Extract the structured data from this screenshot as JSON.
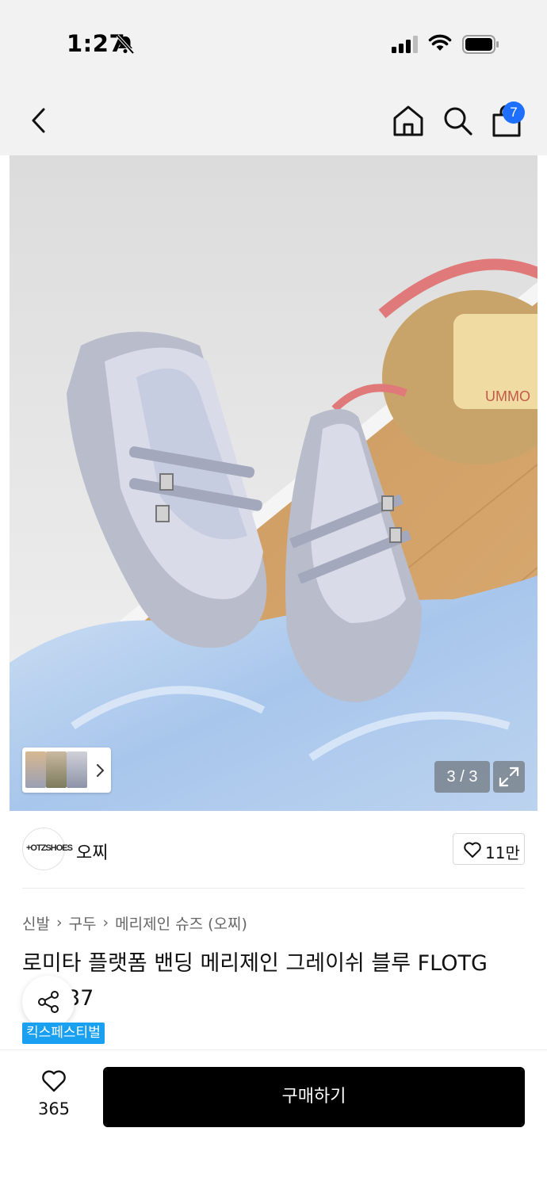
{
  "status_bar": {
    "time": "1:27"
  },
  "nav": {
    "cart_count": "7"
  },
  "gallery": {
    "counter": "3 / 3"
  },
  "brand": {
    "name": "오찌",
    "logo_text": "+OTZSHOES",
    "like_count": "11만"
  },
  "breadcrumb": [
    "신발",
    "구두",
    "메리제인 슈즈 (오찌)"
  ],
  "breadcrumb_sep": "›",
  "product": {
    "title": "로미타 플랫폼 밴딩 메리제인 그레이쉬 블루 FLOTG",
    "title_line2": "37",
    "badge": "킥스페스티벌"
  },
  "bottom_bar": {
    "wish_count": "365",
    "buy_label": "구매하기"
  },
  "colors": {
    "badge": "#1f6fff",
    "festival": "#1aa0f0",
    "buy_button": "#000000"
  }
}
